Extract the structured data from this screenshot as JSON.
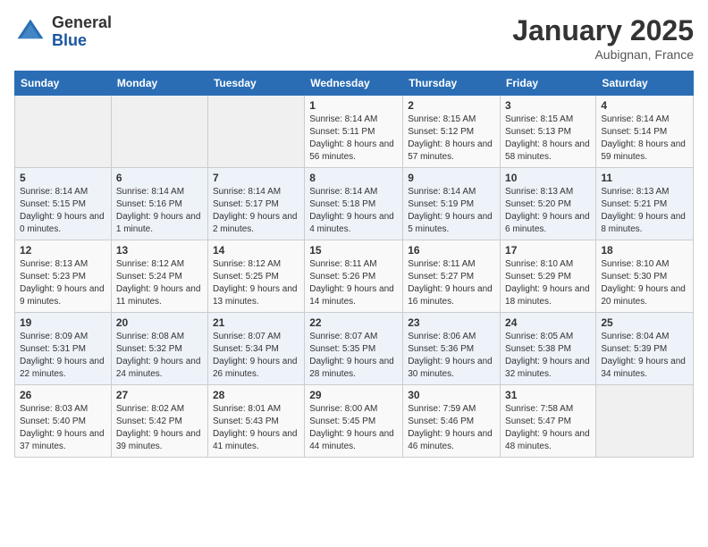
{
  "logo": {
    "general": "General",
    "blue": "Blue"
  },
  "header": {
    "month": "January 2025",
    "location": "Aubignan, France"
  },
  "weekdays": [
    "Sunday",
    "Monday",
    "Tuesday",
    "Wednesday",
    "Thursday",
    "Friday",
    "Saturday"
  ],
  "weeks": [
    [
      {
        "day": "",
        "sunrise": "",
        "sunset": "",
        "daylight": ""
      },
      {
        "day": "",
        "sunrise": "",
        "sunset": "",
        "daylight": ""
      },
      {
        "day": "",
        "sunrise": "",
        "sunset": "",
        "daylight": ""
      },
      {
        "day": "1",
        "sunrise": "Sunrise: 8:14 AM",
        "sunset": "Sunset: 5:11 PM",
        "daylight": "Daylight: 8 hours and 56 minutes."
      },
      {
        "day": "2",
        "sunrise": "Sunrise: 8:15 AM",
        "sunset": "Sunset: 5:12 PM",
        "daylight": "Daylight: 8 hours and 57 minutes."
      },
      {
        "day": "3",
        "sunrise": "Sunrise: 8:15 AM",
        "sunset": "Sunset: 5:13 PM",
        "daylight": "Daylight: 8 hours and 58 minutes."
      },
      {
        "day": "4",
        "sunrise": "Sunrise: 8:14 AM",
        "sunset": "Sunset: 5:14 PM",
        "daylight": "Daylight: 8 hours and 59 minutes."
      }
    ],
    [
      {
        "day": "5",
        "sunrise": "Sunrise: 8:14 AM",
        "sunset": "Sunset: 5:15 PM",
        "daylight": "Daylight: 9 hours and 0 minutes."
      },
      {
        "day": "6",
        "sunrise": "Sunrise: 8:14 AM",
        "sunset": "Sunset: 5:16 PM",
        "daylight": "Daylight: 9 hours and 1 minute."
      },
      {
        "day": "7",
        "sunrise": "Sunrise: 8:14 AM",
        "sunset": "Sunset: 5:17 PM",
        "daylight": "Daylight: 9 hours and 2 minutes."
      },
      {
        "day": "8",
        "sunrise": "Sunrise: 8:14 AM",
        "sunset": "Sunset: 5:18 PM",
        "daylight": "Daylight: 9 hours and 4 minutes."
      },
      {
        "day": "9",
        "sunrise": "Sunrise: 8:14 AM",
        "sunset": "Sunset: 5:19 PM",
        "daylight": "Daylight: 9 hours and 5 minutes."
      },
      {
        "day": "10",
        "sunrise": "Sunrise: 8:13 AM",
        "sunset": "Sunset: 5:20 PM",
        "daylight": "Daylight: 9 hours and 6 minutes."
      },
      {
        "day": "11",
        "sunrise": "Sunrise: 8:13 AM",
        "sunset": "Sunset: 5:21 PM",
        "daylight": "Daylight: 9 hours and 8 minutes."
      }
    ],
    [
      {
        "day": "12",
        "sunrise": "Sunrise: 8:13 AM",
        "sunset": "Sunset: 5:23 PM",
        "daylight": "Daylight: 9 hours and 9 minutes."
      },
      {
        "day": "13",
        "sunrise": "Sunrise: 8:12 AM",
        "sunset": "Sunset: 5:24 PM",
        "daylight": "Daylight: 9 hours and 11 minutes."
      },
      {
        "day": "14",
        "sunrise": "Sunrise: 8:12 AM",
        "sunset": "Sunset: 5:25 PM",
        "daylight": "Daylight: 9 hours and 13 minutes."
      },
      {
        "day": "15",
        "sunrise": "Sunrise: 8:11 AM",
        "sunset": "Sunset: 5:26 PM",
        "daylight": "Daylight: 9 hours and 14 minutes."
      },
      {
        "day": "16",
        "sunrise": "Sunrise: 8:11 AM",
        "sunset": "Sunset: 5:27 PM",
        "daylight": "Daylight: 9 hours and 16 minutes."
      },
      {
        "day": "17",
        "sunrise": "Sunrise: 8:10 AM",
        "sunset": "Sunset: 5:29 PM",
        "daylight": "Daylight: 9 hours and 18 minutes."
      },
      {
        "day": "18",
        "sunrise": "Sunrise: 8:10 AM",
        "sunset": "Sunset: 5:30 PM",
        "daylight": "Daylight: 9 hours and 20 minutes."
      }
    ],
    [
      {
        "day": "19",
        "sunrise": "Sunrise: 8:09 AM",
        "sunset": "Sunset: 5:31 PM",
        "daylight": "Daylight: 9 hours and 22 minutes."
      },
      {
        "day": "20",
        "sunrise": "Sunrise: 8:08 AM",
        "sunset": "Sunset: 5:32 PM",
        "daylight": "Daylight: 9 hours and 24 minutes."
      },
      {
        "day": "21",
        "sunrise": "Sunrise: 8:07 AM",
        "sunset": "Sunset: 5:34 PM",
        "daylight": "Daylight: 9 hours and 26 minutes."
      },
      {
        "day": "22",
        "sunrise": "Sunrise: 8:07 AM",
        "sunset": "Sunset: 5:35 PM",
        "daylight": "Daylight: 9 hours and 28 minutes."
      },
      {
        "day": "23",
        "sunrise": "Sunrise: 8:06 AM",
        "sunset": "Sunset: 5:36 PM",
        "daylight": "Daylight: 9 hours and 30 minutes."
      },
      {
        "day": "24",
        "sunrise": "Sunrise: 8:05 AM",
        "sunset": "Sunset: 5:38 PM",
        "daylight": "Daylight: 9 hours and 32 minutes."
      },
      {
        "day": "25",
        "sunrise": "Sunrise: 8:04 AM",
        "sunset": "Sunset: 5:39 PM",
        "daylight": "Daylight: 9 hours and 34 minutes."
      }
    ],
    [
      {
        "day": "26",
        "sunrise": "Sunrise: 8:03 AM",
        "sunset": "Sunset: 5:40 PM",
        "daylight": "Daylight: 9 hours and 37 minutes."
      },
      {
        "day": "27",
        "sunrise": "Sunrise: 8:02 AM",
        "sunset": "Sunset: 5:42 PM",
        "daylight": "Daylight: 9 hours and 39 minutes."
      },
      {
        "day": "28",
        "sunrise": "Sunrise: 8:01 AM",
        "sunset": "Sunset: 5:43 PM",
        "daylight": "Daylight: 9 hours and 41 minutes."
      },
      {
        "day": "29",
        "sunrise": "Sunrise: 8:00 AM",
        "sunset": "Sunset: 5:45 PM",
        "daylight": "Daylight: 9 hours and 44 minutes."
      },
      {
        "day": "30",
        "sunrise": "Sunrise: 7:59 AM",
        "sunset": "Sunset: 5:46 PM",
        "daylight": "Daylight: 9 hours and 46 minutes."
      },
      {
        "day": "31",
        "sunrise": "Sunrise: 7:58 AM",
        "sunset": "Sunset: 5:47 PM",
        "daylight": "Daylight: 9 hours and 48 minutes."
      },
      {
        "day": "",
        "sunrise": "",
        "sunset": "",
        "daylight": ""
      }
    ]
  ]
}
